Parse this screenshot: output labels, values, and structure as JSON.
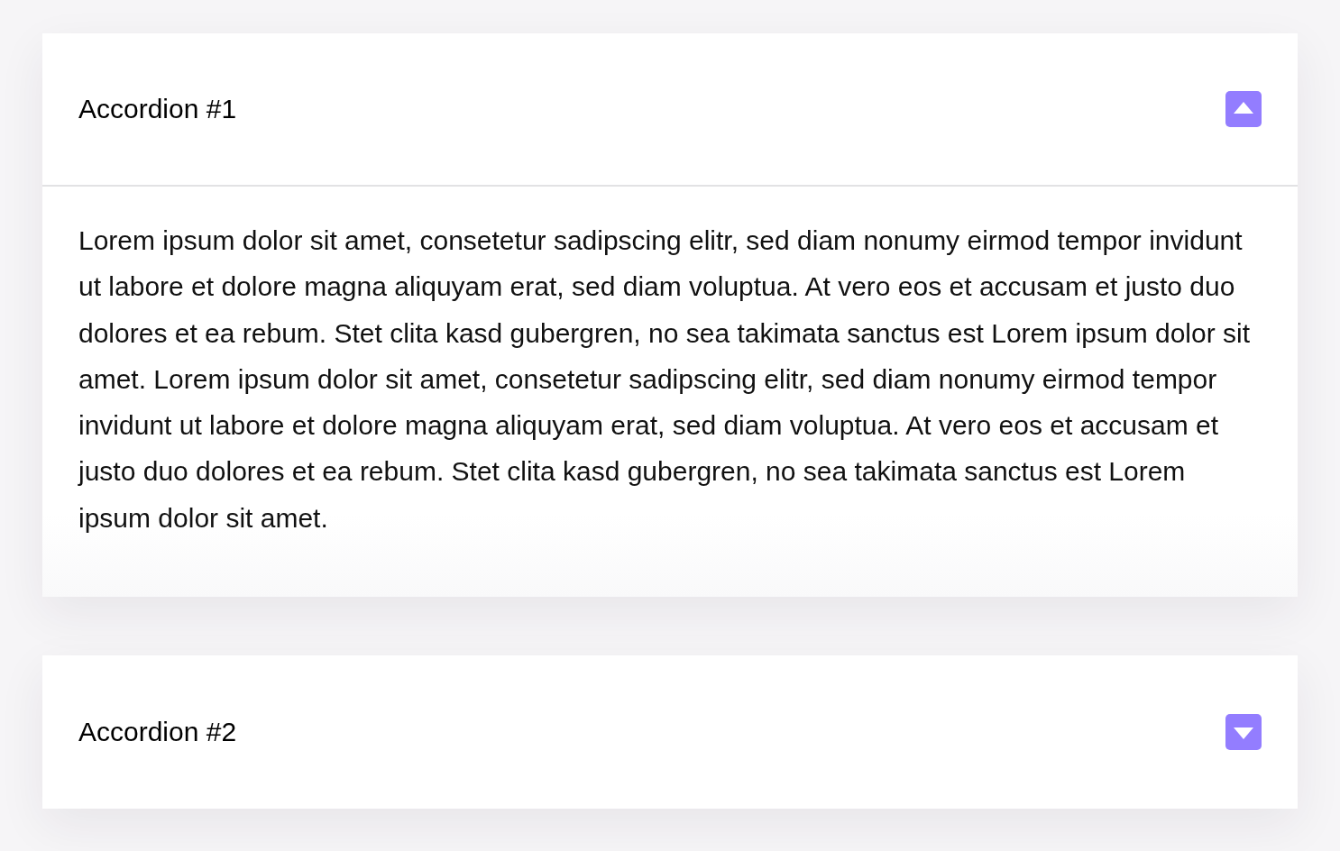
{
  "accordions": [
    {
      "title": "Accordion #1",
      "expanded": true,
      "body": "Lorem ipsum dolor sit amet, consetetur sadipscing elitr, sed diam nonumy eirmod tempor invidunt ut labore et dolore magna aliquyam erat, sed diam voluptua. At vero eos et accusam et justo duo dolores et ea rebum. Stet clita kasd gubergren, no sea takimata sanctus est Lorem ipsum dolor sit amet. Lorem ipsum dolor sit amet, consetetur sadipscing elitr, sed diam nonumy eirmod tempor invidunt ut labore et dolore magna aliquyam erat, sed diam voluptua. At vero eos et accusam et justo duo dolores et ea rebum. Stet clita kasd gubergren, no sea takimata sanctus est Lorem ipsum dolor sit amet."
    },
    {
      "title": "Accordion #2",
      "expanded": false
    }
  ]
}
